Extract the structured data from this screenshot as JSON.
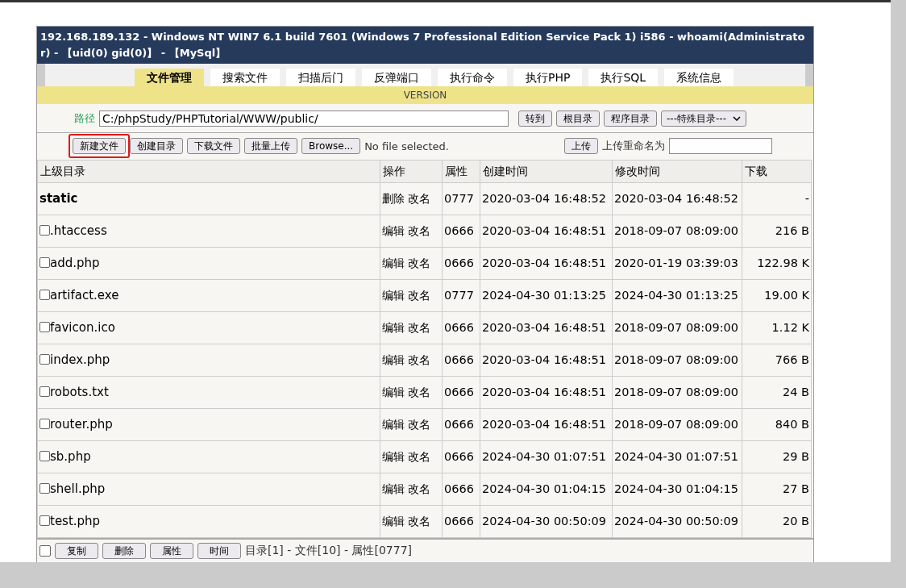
{
  "title": "192.168.189.132 - Windows NT WIN7 6.1 build 7601 (Windows 7 Professional Edition Service Pack 1) i586 - whoami(Administrator) - 【uid(0) gid(0)】 - 【MySql】",
  "tabs": [
    {
      "label": "文件管理",
      "selected": true
    },
    {
      "label": "搜索文件",
      "selected": false
    },
    {
      "label": "扫描后门",
      "selected": false
    },
    {
      "label": "反弹端口",
      "selected": false
    },
    {
      "label": "执行命令",
      "selected": false
    },
    {
      "label": "执行PHP",
      "selected": false
    },
    {
      "label": "执行SQL",
      "selected": false
    },
    {
      "label": "系统信息",
      "selected": false
    }
  ],
  "version": "VERSION",
  "path": {
    "label": "路径",
    "value": "C:/phpStudy/PHPTutorial/WWW/public/",
    "buttons": [
      "转到",
      "根目录",
      "程序目录"
    ],
    "special_dir": "---特殊目录---"
  },
  "upload": {
    "buttons": [
      {
        "label": "新建文件",
        "highlighted": true
      },
      {
        "label": "创建目录",
        "highlighted": false
      },
      {
        "label": "下载文件",
        "highlighted": false
      },
      {
        "label": "批量上传",
        "highlighted": false
      }
    ],
    "browse": "Browse...",
    "file_status": "No file selected.",
    "upload_button": "上传",
    "rename_label": "上传重命名为"
  },
  "table": {
    "columns": [
      "上级目录",
      "操作",
      "属性",
      "创建时间",
      "修改时间",
      "下载"
    ],
    "rows": [
      {
        "kind": "dir",
        "name": "static",
        "ops": [
          "删除",
          "改名"
        ],
        "perm": "0777",
        "created": "2020-03-04 16:48:52",
        "modified": "2020-03-04 16:48:52",
        "size": "-"
      },
      {
        "kind": "file",
        "checked": false,
        "name": ".htaccess",
        "ops": [
          "编辑",
          "改名"
        ],
        "perm": "0666",
        "created": "2020-03-04 16:48:51",
        "modified": "2018-09-07 08:09:00",
        "size": "216 B"
      },
      {
        "kind": "file",
        "checked": false,
        "name": "add.php",
        "ops": [
          "编辑",
          "改名"
        ],
        "perm": "0666",
        "created": "2020-03-04 16:48:51",
        "modified": "2020-01-19 03:39:03",
        "size": "122.98 K"
      },
      {
        "kind": "file",
        "checked": false,
        "name": "artifact.exe",
        "ops": [
          "编辑",
          "改名"
        ],
        "perm": "0777",
        "created": "2024-04-30 01:13:25",
        "modified": "2024-04-30 01:13:25",
        "size": "19.00 K"
      },
      {
        "kind": "file",
        "checked": false,
        "name": "favicon.ico",
        "ops": [
          "编辑",
          "改名"
        ],
        "perm": "0666",
        "created": "2020-03-04 16:48:51",
        "modified": "2018-09-07 08:09:00",
        "size": "1.12 K"
      },
      {
        "kind": "file",
        "checked": false,
        "name": "index.php",
        "ops": [
          "编辑",
          "改名"
        ],
        "perm": "0666",
        "created": "2020-03-04 16:48:51",
        "modified": "2018-09-07 08:09:00",
        "size": "766 B"
      },
      {
        "kind": "file",
        "checked": false,
        "name": "robots.txt",
        "ops": [
          "编辑",
          "改名"
        ],
        "perm": "0666",
        "created": "2020-03-04 16:48:51",
        "modified": "2018-09-07 08:09:00",
        "size": "24 B"
      },
      {
        "kind": "file",
        "checked": false,
        "name": "router.php",
        "ops": [
          "编辑",
          "改名"
        ],
        "perm": "0666",
        "created": "2020-03-04 16:48:51",
        "modified": "2018-09-07 08:09:00",
        "size": "840 B"
      },
      {
        "kind": "file",
        "checked": false,
        "name": "sb.php",
        "ops": [
          "编辑",
          "改名"
        ],
        "perm": "0666",
        "created": "2024-04-30 01:07:51",
        "modified": "2024-04-30 01:07:51",
        "size": "29 B"
      },
      {
        "kind": "file",
        "checked": false,
        "name": "shell.php",
        "ops": [
          "编辑",
          "改名"
        ],
        "perm": "0666",
        "created": "2024-04-30 01:04:15",
        "modified": "2024-04-30 01:04:15",
        "size": "27 B"
      },
      {
        "kind": "file",
        "checked": false,
        "name": "test.php",
        "ops": [
          "编辑",
          "改名"
        ],
        "perm": "0666",
        "created": "2024-04-30 00:50:09",
        "modified": "2024-04-30 00:50:09",
        "size": "20 B"
      }
    ]
  },
  "footer": {
    "checked": false,
    "buttons": [
      "复制",
      "删除",
      "属性",
      "时间"
    ],
    "summary": "目录[1] - 文件[10] - 属性[0777]"
  }
}
